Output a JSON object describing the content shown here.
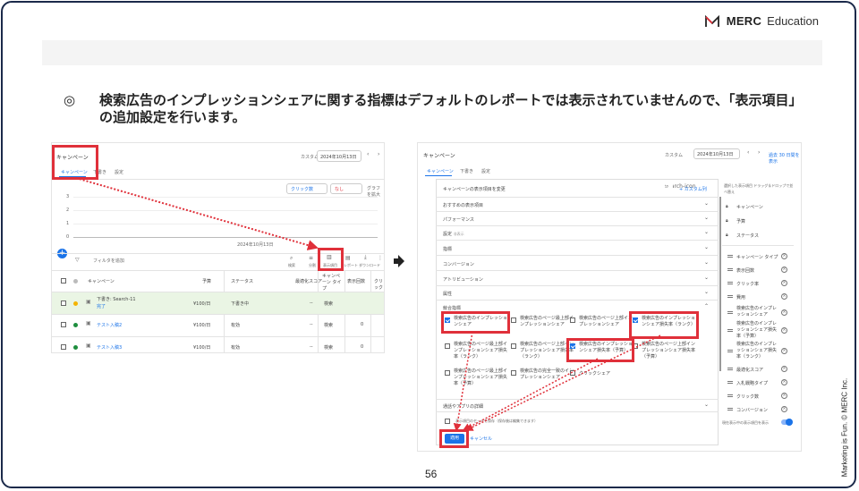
{
  "brand": {
    "name_bold": "MERC",
    "name_light": "Education"
  },
  "heading": {
    "bullet": "◎",
    "text": "検索広告のインプレッションシェアに関する指標はデフォルトのレポートでは表示されていませんので、「表示項目」の追加設定を行います。"
  },
  "sidebar_text": "Marketing is Fun. © MERC Inc.",
  "page_number": "56",
  "colors": {
    "highlight": "#e0303a",
    "accent": "#1a73e8",
    "frame": "#1b2a4a"
  },
  "shot1": {
    "title": "キャンペーン",
    "tabs": [
      "キャンペーン",
      "下書き",
      "設定"
    ],
    "custom_label": "カスタム",
    "date": "2024年10月13日",
    "chart_y": [
      "3",
      "2",
      "1",
      "0"
    ],
    "chart_date": "2024年10月13日",
    "metric_btn1": "クリック数",
    "metric_btn2": "なし",
    "expand": "グラフを拡大",
    "filter": "フィルタを追加",
    "tools": [
      "検索",
      "分割",
      "表示項目",
      "レポート",
      "ダウンロード",
      "展開"
    ],
    "headers": [
      "キャンペーン",
      "予算",
      "ステータス",
      "最適化スコア",
      "キャンペーン タイプ",
      "表示回数",
      "クリック"
    ],
    "rows": [
      {
        "name": "下書き: Search-11",
        "sub": "完了",
        "budget": "¥100/日",
        "status": "下書き中",
        "score": "--",
        "type": "検索",
        "impr": ""
      },
      {
        "name": "テスト入稿2",
        "sub": "",
        "budget": "¥100/日",
        "status": "有効",
        "score": "--",
        "type": "検索",
        "impr": "0"
      },
      {
        "name": "テスト入稿3",
        "sub": "",
        "budget": "¥100/日",
        "status": "有効",
        "score": "--",
        "type": "検索",
        "impr": "0"
      }
    ]
  },
  "shot2": {
    "title": "キャンペーン",
    "custom_label": "カスタム",
    "date": "2024年10月13日",
    "link": "過去 30 日間を表示",
    "tabs": [
      "キャンペーン",
      "下書き",
      "設定"
    ],
    "panel_title": "キャンペーンの表示項目を変更",
    "search_icon": "search-icon",
    "custom_btn": "+ カスタム列",
    "groups": [
      "おすすめの表示項目",
      "パフォーマンス",
      "設定",
      "指標",
      "コンバージョン",
      "アトリビューション",
      "属性",
      "競合指標"
    ],
    "group_note": "非表示",
    "options": [
      {
        "label": "検索広告のインプレッションシェア",
        "checked": true
      },
      {
        "label": "検索広告のページ最上部インプレッションシェア",
        "checked": false
      },
      {
        "label": "検索広告のページ上部インプレッションシェア",
        "checked": false
      },
      {
        "label": "検索広告のインプレッションシェア損失率（ランク）",
        "checked": true
      },
      {
        "label": "検索広告のページ最上部インプレッションシェア損失率（ランク）",
        "checked": false
      },
      {
        "label": "検索広告のページ上部インプレッションシェア損失率（ランク）",
        "checked": false
      },
      {
        "label": "検索広告のインプレッションシェア損失率（予算）",
        "checked": true
      },
      {
        "label": "検索広告のページ上部インプレッションシェア損失率（予算）",
        "checked": false
      },
      {
        "label": "検索広告のページ最上部インプレッションシェア損失率（予算）",
        "checked": false
      },
      {
        "label": "検索広告の完全一致のインプレッションシェア",
        "checked": false
      },
      {
        "label": "クリックシェア",
        "checked": false
      }
    ],
    "more_group": "通話やアプリの詳細",
    "save_label": "表示項目のセットを保存（保存後は編集できます）",
    "apply": "適用",
    "cancel": "キャンセル",
    "right_header": "選択した表示項目 ドラッグ＆ドロップで並べ替え",
    "locked": [
      "キャンペーン",
      "予算",
      "ステータス"
    ],
    "selected": [
      "キャンペーン タイプ",
      "表示回数",
      "クリック率",
      "費用",
      "検索広告のインプレッションシェア",
      "検索広告のインプレッションシェア損失率（予算）",
      "検索広告のインプレッションシェア損失率（ランク）",
      "最適化スコア",
      "入札戦略タイプ",
      "クリック数",
      "コンバージョン"
    ],
    "toggle_label": "現在表示中の表示項目を表示"
  }
}
